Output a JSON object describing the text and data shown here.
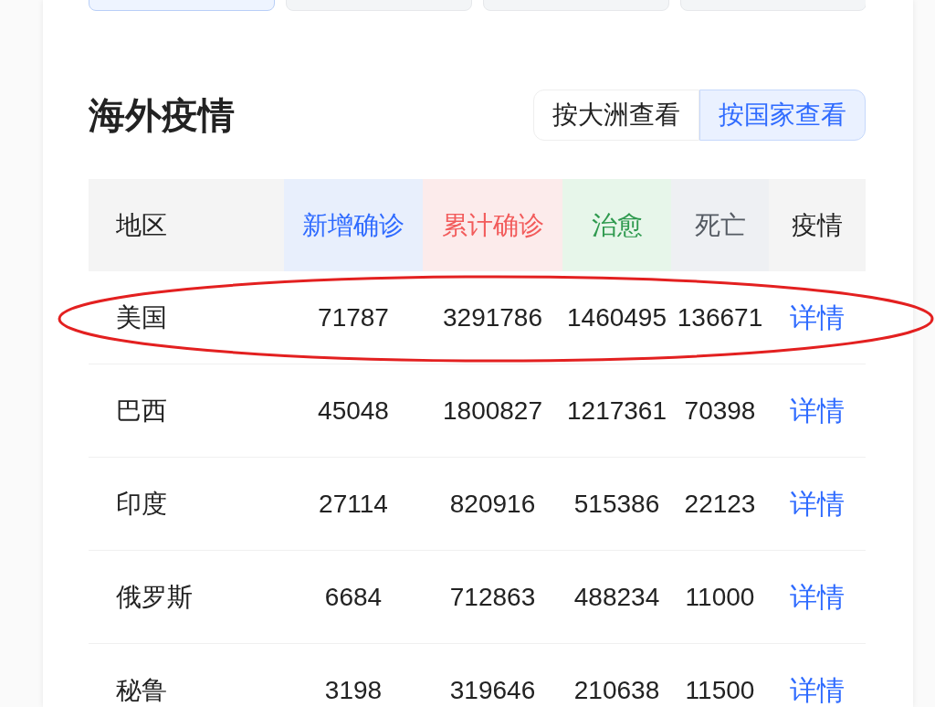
{
  "top_tabs": [
    {
      "selected": true
    },
    {
      "selected": false
    },
    {
      "selected": false
    },
    {
      "selected": false
    }
  ],
  "section": {
    "title": "海外疫情",
    "toggle": [
      {
        "label": "按大洲查看",
        "selected": false
      },
      {
        "label": "按国家查看",
        "selected": true
      }
    ]
  },
  "table": {
    "columns": [
      {
        "label": "地区",
        "kind": "plain"
      },
      {
        "label": "新增确诊",
        "kind": "new"
      },
      {
        "label": "累计确诊",
        "kind": "total"
      },
      {
        "label": "治愈",
        "kind": "cured"
      },
      {
        "label": "死亡",
        "kind": "dead"
      },
      {
        "label": "疫情",
        "kind": "plain"
      }
    ],
    "rows": [
      {
        "highlighted": true,
        "cells": [
          "美国",
          "71787",
          "3291786",
          "1460495",
          "136671"
        ],
        "link": "详情"
      },
      {
        "highlighted": false,
        "cells": [
          "巴西",
          "45048",
          "1800827",
          "1217361",
          "70398"
        ],
        "link": "详情"
      },
      {
        "highlighted": false,
        "cells": [
          "印度",
          "27114",
          "820916",
          "515386",
          "22123"
        ],
        "link": "详情"
      },
      {
        "highlighted": false,
        "cells": [
          "俄罗斯",
          "6684",
          "712863",
          "488234",
          "11000"
        ],
        "link": "详情"
      },
      {
        "highlighted": false,
        "cells": [
          "秘鲁",
          "3198",
          "319646",
          "210638",
          "11500"
        ],
        "link": "详情"
      }
    ]
  }
}
